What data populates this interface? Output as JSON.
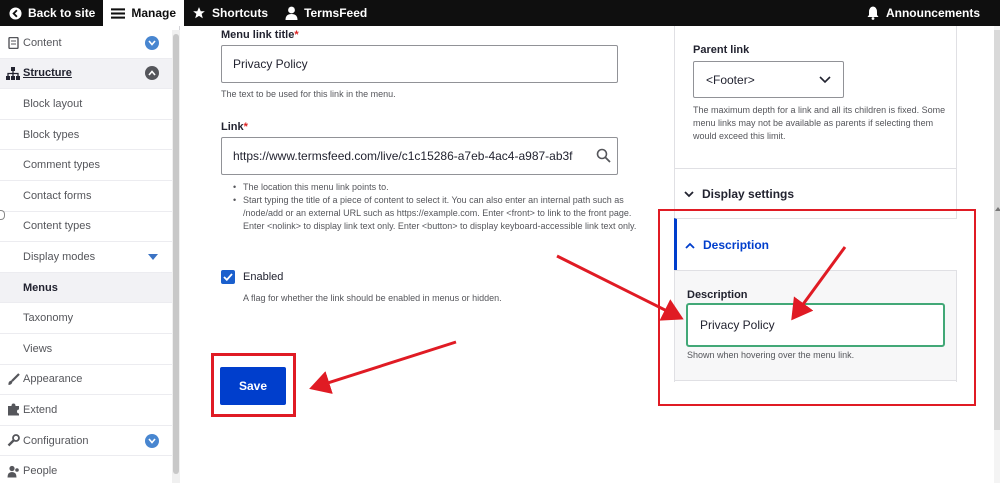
{
  "toolbar": {
    "back": "Back to site",
    "manage": "Manage",
    "shortcuts": "Shortcuts",
    "user": "TermsFeed",
    "announcements": "Announcements"
  },
  "sidebar": {
    "items": [
      {
        "label": "Content"
      },
      {
        "label": "Structure"
      },
      {
        "label": "Block layout"
      },
      {
        "label": "Block types"
      },
      {
        "label": "Comment types"
      },
      {
        "label": "Contact forms"
      },
      {
        "label": "Content types"
      },
      {
        "label": "Display modes"
      },
      {
        "label": "Menus"
      },
      {
        "label": "Taxonomy"
      },
      {
        "label": "Views"
      },
      {
        "label": "Appearance"
      },
      {
        "label": "Extend"
      },
      {
        "label": "Configuration"
      },
      {
        "label": "People"
      }
    ]
  },
  "form": {
    "title_label": "Menu link title",
    "required_mark": "*",
    "title_value": "Privacy Policy",
    "title_desc": "The text to be used for this link in the menu.",
    "link_label": "Link",
    "link_value": "https://www.termsfeed.com/live/c1c15286-a7eb-4ac4-a987-ab3f",
    "link_desc": [
      "The location this menu link points to.",
      "Start typing the title of a piece of content to select it. You can also enter an internal path such as /node/add or an external URL such as https://example.com. Enter <front> to link to the front page. Enter <nolink> to display link text only. Enter <button> to display keyboard-accessible link text only."
    ],
    "enabled_label": "Enabled",
    "enabled_checked": true,
    "enabled_desc": "A flag for whether the link should be enabled in menus or hidden.",
    "save_label": "Save"
  },
  "panel": {
    "parent_label": "Parent link",
    "parent_value": "<Footer>",
    "parent_desc": "The maximum depth for a link and all its children is fixed. Some menu links may not be available as parents if selecting them would exceed this limit.",
    "display_settings": "Display settings",
    "description_summary": "Description",
    "description_label": "Description",
    "description_value": "Privacy Policy",
    "description_desc": "Shown when hovering over the menu link."
  },
  "colors": {
    "primary": "#003ecc",
    "annotation": "#e01b24",
    "focus": "#42a877"
  }
}
